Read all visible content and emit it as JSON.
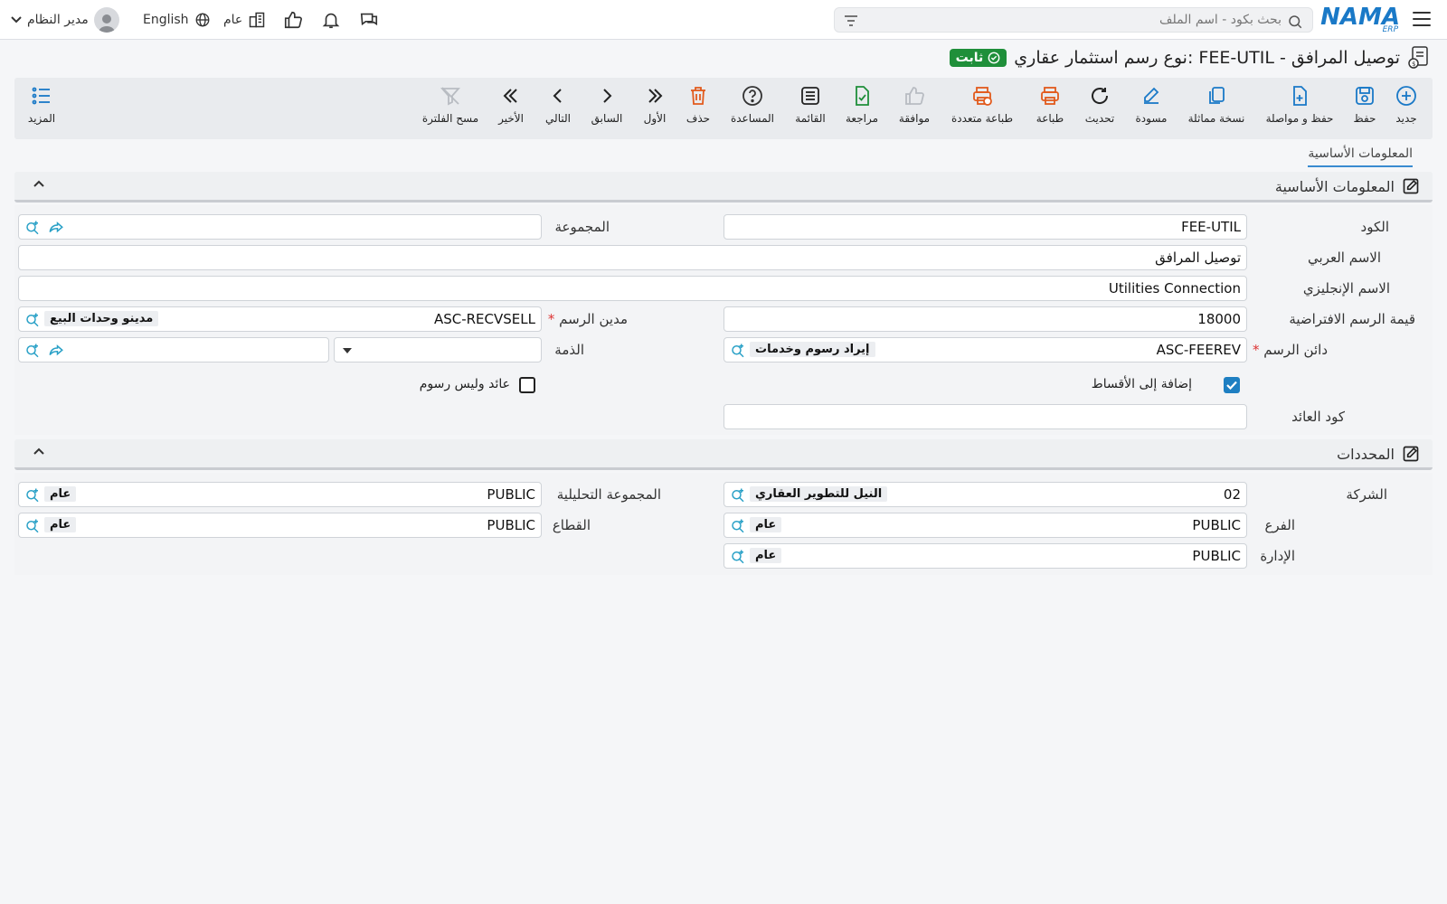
{
  "topbar": {
    "search_placeholder": "بحث بكود - اسم الملف",
    "user_name": "مدير النظام",
    "language": "English",
    "branch": "عام"
  },
  "page": {
    "title": "نوع رسم استثمار عقاري: FEE-UTIL - توصيل المرافق",
    "status_badge": "ثابت"
  },
  "toolbar": {
    "new": "جديد",
    "save": "حفظ",
    "save_continue": "حفظ و مواصلة",
    "duplicate": "نسخة مماثلة",
    "draft": "مسودة",
    "refresh": "تحديث",
    "print": "طباعة",
    "multi_print": "طباعة متعددة",
    "approve": "موافقة",
    "review": "مراجعة",
    "list": "القائمة",
    "help": "المساعدة",
    "delete": "حذف",
    "first": "الأول",
    "previous": "السابق",
    "next": "التالي",
    "last": "الأخير",
    "clear_filter": "مسح الفلترة",
    "more": "المزيد"
  },
  "tabs": {
    "basic": "المعلومات الأساسية"
  },
  "sections": {
    "basic": "المعلومات الأساسية",
    "dimensions": "المحددات"
  },
  "basic": {
    "code_label": "الكود",
    "code_value": "FEE-UTIL",
    "group_label": "المجموعة",
    "arabic_name_label": "الاسم العربي",
    "arabic_name_value": "توصيل المرافق",
    "english_name_label": "الاسم الإنجليزي",
    "english_name_value": "Utilities Connection",
    "default_value_label": "قيمة الرسم الافتراضية",
    "default_value": "18000",
    "fee_debtor_label": "مدين الرسم",
    "fee_debtor_code": "ASC-RECVSELL",
    "fee_debtor_name": "مدينو وحدات البيع",
    "fee_creditor_label": "دائن الرسم",
    "fee_creditor_code": "ASC-FEEREV",
    "fee_creditor_name": "إيراد رسوم وخدمات",
    "account_label": "الذمة",
    "add_installments_label": "إضافة إلى الأقساط",
    "add_installments": true,
    "revenue_not_fee_label": "عائد وليس رسوم",
    "revenue_not_fee": false,
    "revenue_code_label": "كود العائد",
    "revenue_code_value": ""
  },
  "dimensions": {
    "company_label": "الشركة",
    "company_code": "02",
    "company_name": "النيل للتطوير العقاري",
    "analysis_group_label": "المجموعة التحليلية",
    "analysis_group_code": "PUBLIC",
    "analysis_group_name": "عام",
    "branch_label": "الفرع",
    "branch_code": "PUBLIC",
    "branch_name": "عام",
    "sector_label": "القطاع",
    "sector_code": "PUBLIC",
    "sector_name": "عام",
    "department_label": "الإدارة",
    "department_code": "PUBLIC",
    "department_name": "عام"
  },
  "colors": {
    "accent": "#1a79c7",
    "status_green": "#1f8f3a",
    "danger_orange": "#e25a1c",
    "icon_teal": "#2aa1c7"
  }
}
